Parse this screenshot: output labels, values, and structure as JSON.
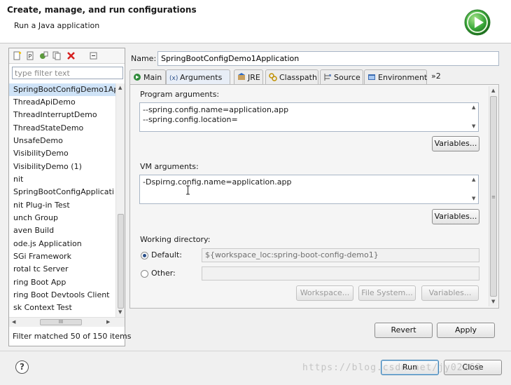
{
  "header": {
    "title": "Create, manage, and run configurations",
    "subtitle": "Run a Java application"
  },
  "left_panel": {
    "filter_placeholder": "type filter text",
    "items": [
      "SpringBootConfigDemo1Ap",
      "ThreadApiDemo",
      "ThreadInterruptDemo",
      "ThreadStateDemo",
      "UnsafeDemo",
      "VisibilityDemo",
      "VisibilityDemo (1)",
      "nit",
      "SpringBootConfigApplicati",
      "nit Plug-in Test",
      "unch Group",
      "aven Build",
      "ode.js Application",
      "SGi Framework",
      "rotal tc Server",
      "ring Boot App",
      "ring Boot Devtools Client",
      "sk Context Test"
    ],
    "selected_index": 0,
    "hscroll_grip": "III",
    "filter_status": "Filter matched 50 of 150 items"
  },
  "config": {
    "name_label": "Name:",
    "name_value": "SpringBootConfigDemo1Application",
    "tabs": [
      "Main",
      "Arguments",
      "JRE",
      "Classpath",
      "Source",
      "Environment"
    ],
    "tab_overflow": "»2",
    "active_tab": "Arguments",
    "program_args_label": "Program arguments:",
    "program_args_lines": [
      "--spring.config.name=application,app",
      "--spring.config.location="
    ],
    "vm_args_label": "VM arguments:",
    "vm_args_value": "-Dspirng.config.name=application.app",
    "variables_label": "Variables...",
    "working_dir_label": "Working directory:",
    "default_label": "Default:",
    "default_value": "${workspace_loc:spring-boot-config-demo1}",
    "other_label": "Other:",
    "other_value": "",
    "workspace_btn": "Workspace...",
    "filesystem_btn": "File System...",
    "wd_variables_btn": "Variables...",
    "revert_btn": "Revert",
    "apply_btn": "Apply"
  },
  "footer": {
    "run_btn": "Run",
    "close_btn": "Close",
    "help_glyph": "?",
    "watermark": "https://blog.csdn.net/jy02268"
  },
  "colors": {
    "selection": "#cfe3f7",
    "run_logo": "#3aa83a",
    "accent_border": "#3c7fb1"
  }
}
